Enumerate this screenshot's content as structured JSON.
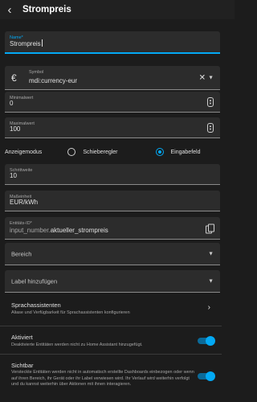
{
  "header": {
    "title": "Strompreis"
  },
  "name_field": {
    "label": "Name*",
    "value": "Strompreis"
  },
  "symbol_field": {
    "label": "Symbol",
    "value": "mdi:currency-eur",
    "icon_glyph": "€"
  },
  "min_field": {
    "label": "Minimalwert",
    "value": "0"
  },
  "max_field": {
    "label": "Maximalwert",
    "value": "100"
  },
  "display_mode": {
    "label": "Anzeigemodus",
    "options": [
      "Schieberegler",
      "Eingabefeld"
    ],
    "selected": "Eingabefeld"
  },
  "step_field": {
    "label": "Schrittweite",
    "value": "10"
  },
  "unit_field": {
    "label": "Maßeinheit",
    "value": "EUR/kWh"
  },
  "entity_field": {
    "label": "Entitäts-ID*",
    "prefix": "input_number.",
    "suffix": "aktueller_strompreis"
  },
  "area_select": {
    "label": "Bereich"
  },
  "labels_select": {
    "label": "Label hinzufügen"
  },
  "voice_assistants": {
    "title": "Sprachassistenten",
    "description": "Aliase und Verfügbarkeit für Sprachassistenten konfigurieren"
  },
  "enabled": {
    "title": "Aktiviert",
    "description": "Deaktivierte Entitäten werden nicht zu Home Assistant hinzugefügt.",
    "on": true
  },
  "visible": {
    "title": "Sichtbar",
    "description": "Versteckte Entitäten werden nicht in automatisch erstellte Dashboards einbezogen oder wenn auf ihren Bereich, ihr Gerät oder ihr Label verwiesen wird. Ihr Verlauf wird weiterhin verfolgt und du kannst weiterhin über Aktionen mit ihnen interagieren.",
    "on": true
  },
  "colors": {
    "accent": "#03a9f4",
    "background": "#1c1c1c",
    "field": "#2c2c2c"
  }
}
